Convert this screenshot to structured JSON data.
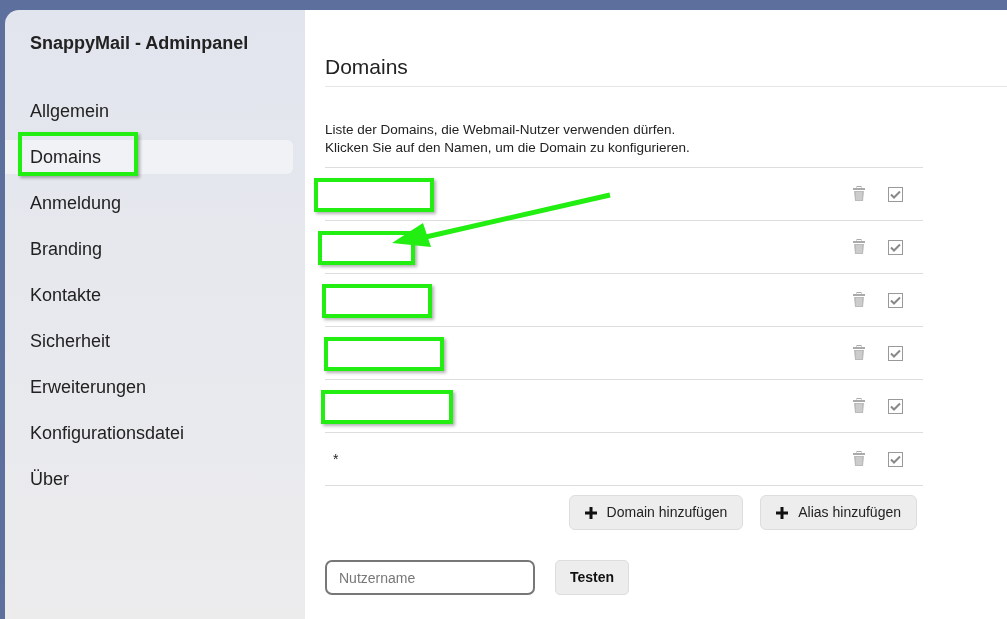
{
  "sidebar": {
    "title": "SnappyMail - Adminpanel",
    "items": [
      {
        "label": "Allgemein",
        "selected": false,
        "highlighted": false
      },
      {
        "label": "Domains",
        "selected": true,
        "highlighted": true
      },
      {
        "label": "Anmeldung",
        "selected": false,
        "highlighted": false
      },
      {
        "label": "Branding",
        "selected": false,
        "highlighted": false
      },
      {
        "label": "Kontakte",
        "selected": false,
        "highlighted": false
      },
      {
        "label": "Sicherheit",
        "selected": false,
        "highlighted": false
      },
      {
        "label": "Erweiterungen",
        "selected": false,
        "highlighted": false
      },
      {
        "label": "Konfigurationsdatei",
        "selected": false,
        "highlighted": false
      },
      {
        "label": "Über",
        "selected": false,
        "highlighted": false
      }
    ]
  },
  "page": {
    "title": "Domains",
    "description": [
      "Liste der Domains, die Webmail-Nutzer verwenden dürfen.",
      "Klicken Sie auf den Namen, um die Domain zu konfigurieren."
    ],
    "domains": [
      {
        "highlighted": true,
        "arrow": false,
        "checked": true
      },
      {
        "highlighted": true,
        "arrow": true,
        "checked": true
      },
      {
        "highlighted": true,
        "arrow": false,
        "checked": true
      },
      {
        "highlighted": true,
        "arrow": false,
        "checked": true
      },
      {
        "highlighted": true,
        "arrow": false,
        "checked": true
      },
      {
        "name": "*",
        "highlighted": false,
        "arrow": false,
        "checked": true
      }
    ],
    "buttons": [
      {
        "label": "Domain hinzufügen"
      },
      {
        "label": "Alias hinzufügen"
      }
    ],
    "test": {
      "placeholder": "Nutzername",
      "button": "Testen"
    }
  }
}
